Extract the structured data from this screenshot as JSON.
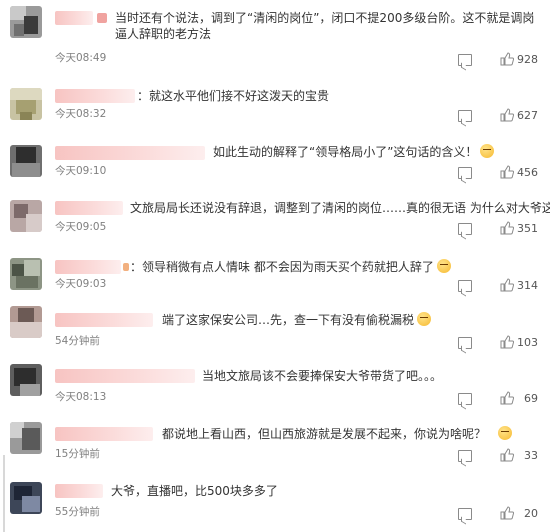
{
  "comments": [
    {
      "text": "当时还有个说法，调到了“清闲的岗位”，闭口不提200多级台阶。这不就是调岗逼人辞职的老方法",
      "time": "今天08:49",
      "likes": "928"
    },
    {
      "text": "：就这水平他们接不好这泼天的宝贵",
      "time": "今天08:32",
      "likes": "627"
    },
    {
      "text": "如此生动的解释了“领导格局小了”这句话的含义！",
      "time": "今天09:10",
      "likes": "456"
    },
    {
      "text": "文旅局局长还说没有辞退，调整到了清闲的岗位……真的很无语 为什么对大爷这样",
      "time": "今天09:05",
      "likes": "351"
    },
    {
      "text": "：领导稍微有点人情味 都不会因为雨天买个药就把人辞了",
      "time": "今天09:03",
      "likes": "314"
    },
    {
      "text": "端了这家保安公司…先，查一下有没有偷税漏税",
      "time": "54分钟前",
      "likes": "103"
    },
    {
      "text": "当地文旅局该不会要捧保安大爷带货了吧。。。",
      "time": "今天08:13",
      "likes": "69"
    },
    {
      "text": "都说地上看山西，但山西旅游就是发展不起来，你说为啥呢？",
      "time": "15分钟前",
      "likes": "33"
    },
    {
      "text": "大爷，直播吧，比500块多多了",
      "time": "55分钟前",
      "likes": "20"
    }
  ],
  "icons": {
    "comment": "comment-icon",
    "like": "thumbs-up-icon"
  }
}
